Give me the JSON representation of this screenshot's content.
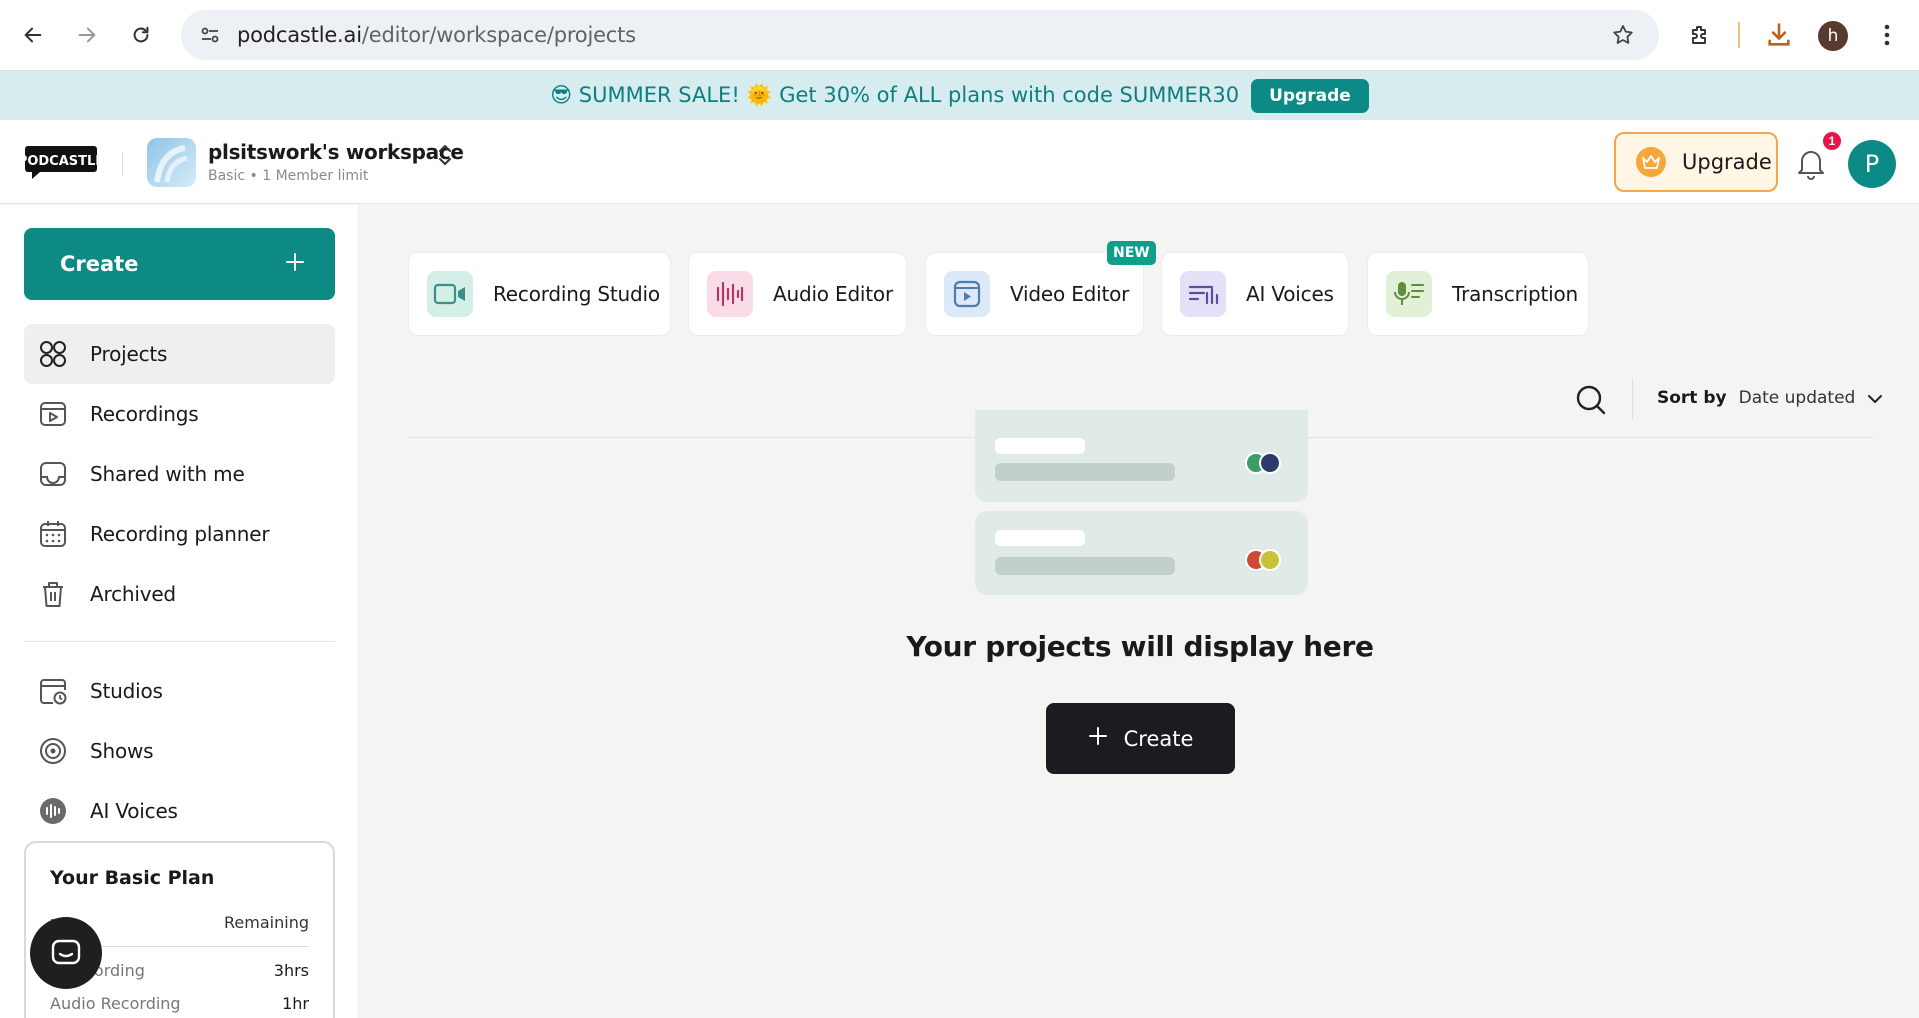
{
  "browser": {
    "url_host": "podcastle.ai",
    "url_path": "/editor/workspace/projects",
    "profile_initial": "h"
  },
  "promo": {
    "text": "😎 SUMMER SALE! 🌞 Get 30% of ALL plans with code SUMMER30",
    "button_label": "Upgrade"
  },
  "header": {
    "workspace_name": "plsitswork's workspace",
    "workspace_sub": "Basic • 1 Member limit",
    "upgrade_label": "Upgrade",
    "notification_count": "1",
    "user_initial": "P"
  },
  "sidebar": {
    "create_label": "Create",
    "items": [
      {
        "label": "Projects",
        "icon": "grid-icon"
      },
      {
        "label": "Recordings",
        "icon": "recordings-icon"
      },
      {
        "label": "Shared with me",
        "icon": "inbox-icon"
      },
      {
        "label": "Recording planner",
        "icon": "calendar-icon"
      },
      {
        "label": "Archived",
        "icon": "trash-icon"
      },
      {
        "label": "Studios",
        "icon": "studio-calendar-icon"
      },
      {
        "label": "Shows",
        "icon": "podcast-icon"
      },
      {
        "label": "AI Voices",
        "icon": "ai-voices-icon"
      }
    ],
    "plan": {
      "title": "Your Basic Plan",
      "col_feature": "ure",
      "col_remaining": "Remaining",
      "rows": [
        {
          "label": "o Recording",
          "value": "3hrs"
        },
        {
          "label": "Audio Recording",
          "value": "1hr"
        }
      ]
    }
  },
  "tools": [
    {
      "label": "Recording Studio",
      "icon": "camera-icon",
      "color": "#d4efe8"
    },
    {
      "label": "Audio Editor",
      "icon": "waveform-icon",
      "color": "#fadbe8"
    },
    {
      "label": "Video Editor",
      "icon": "video-icon",
      "color": "#dbe9f8",
      "badge": "NEW"
    },
    {
      "label": "AI Voices",
      "icon": "ai-voice-icon",
      "color": "#e4e0f6"
    },
    {
      "label": "Transcription",
      "icon": "mic-text-icon",
      "color": "#e1f0d6"
    }
  ],
  "toolbar": {
    "sort_key": "Sort by",
    "sort_value": "Date updated"
  },
  "empty": {
    "title": "Your projects will display here",
    "create_label": "Create"
  },
  "colors": {
    "brand": "#0e8a84",
    "upgrade_border": "#f3a64a",
    "badge_red": "#e8154c"
  }
}
